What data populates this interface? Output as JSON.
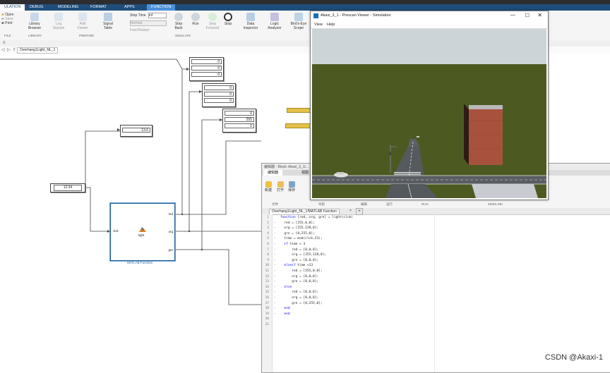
{
  "simulink": {
    "tabs": [
      "ULATION",
      "DEBUG",
      "MODELING",
      "FORMAT",
      "APPS",
      "FUNCTION"
    ],
    "active_tab": "ULATION",
    "file_buttons": [
      "Open",
      "Save",
      "Print"
    ],
    "library_browser": "Library\nBrowser",
    "prepare_buttons": [
      "Log\nSignals",
      "Add\nViewer",
      "Signal\nTable"
    ],
    "stop_time_label": "Stop Time",
    "stop_time_value": "inf",
    "mode_value": "Normal",
    "fast_restart": "Fast Restart",
    "simulate_buttons": [
      "Step\nBack",
      "Run",
      "Step\nForward",
      "Stop"
    ],
    "review_buttons": [
      "Data\nInspector",
      "Logic\nAnalyzer",
      "Bird's-Eye\nScope"
    ],
    "group_labels": {
      "file": "FILE",
      "library": "LIBRARY",
      "prepare": "PREPARE",
      "simulate": "SIMULATE"
    },
    "tab_label": "Overhang1Light_NL_1",
    "blocks": {
      "clock_display": "12:34",
      "time_display": "13.6",
      "display1": [
        "0",
        "0",
        "0"
      ],
      "display2": [
        "0",
        "0",
        "0"
      ],
      "display3": [
        "0",
        "255",
        "0"
      ],
      "func_ports_in": "clck",
      "func_ports_out": [
        "red",
        "org",
        "gre"
      ],
      "func_name": "light",
      "func_caption": "MATLAB Function"
    }
  },
  "editor": {
    "title": "编辑器 - Block: Akaxi_3_1/...",
    "tabs": [
      "编辑器",
      "视图"
    ],
    "buttons": [
      "新建",
      "打开",
      "保存"
    ],
    "groups": [
      "文件",
      "导航",
      "编辑",
      "断点",
      "运行",
      "SIMULINK"
    ],
    "group_run": "RUN",
    "file_tab": "Overhang1Light_NL_1/MATLAB Function",
    "lines": [
      "function [red, org, gre] = light(clck)",
      "  red = [255,0,0];",
      "  org = [255,128,0];",
      "  gre = [0,255,0];",
      "  time = mod(clck,23);",
      "  if time < 3",
      "      red = [0,0,0];",
      "      org = [255,128,0];",
      "      gre = [0,0,0];",
      "  elseif time <13",
      "      red = [255,0,0];",
      "      org = [0,0,0];",
      "      gre = [0,0,0];",
      "  else",
      "      red = [0,0,0];",
      "      org = [0,0,0];",
      "      gre = [0,255,0];",
      "  end",
      "  end",
      "",
      ""
    ]
  },
  "viewer": {
    "title": "Akaxi_3_1 - Prescan Viewer - Simulation",
    "menu": [
      "View",
      "Help"
    ]
  },
  "watermark": "CSDN @Akaxi-1"
}
